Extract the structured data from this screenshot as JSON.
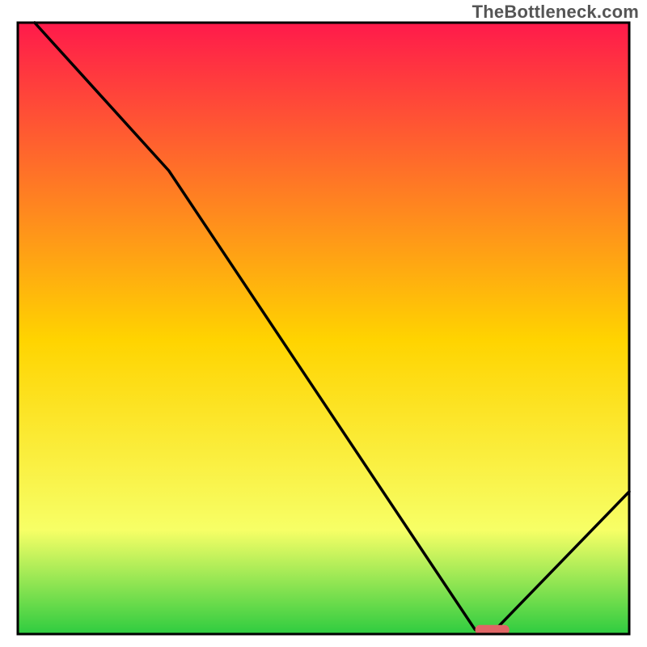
{
  "attribution": "TheBottleneck.com",
  "colors": {
    "stroke": "#000000",
    "marker_fill": "#e06666",
    "border": "#000000",
    "grad_top": "#ff1a4b",
    "grad_mid": "#ffd400",
    "grad_lemon": "#f7ff66",
    "grad_green": "#2ecc40"
  },
  "chart_data": {
    "type": "line",
    "title": "",
    "xlabel": "",
    "ylabel": "",
    "xlim": [
      0,
      100
    ],
    "ylim": [
      0,
      100
    ],
    "series": [
      {
        "name": "curve",
        "x": [
          2.75,
          24.7,
          74.8,
          78.1,
          100
        ],
        "y": [
          100,
          75.8,
          0.7,
          0.7,
          23.3
        ]
      }
    ],
    "marker": {
      "x_start": 74.8,
      "x_end": 80.4,
      "y": 0.7
    }
  }
}
